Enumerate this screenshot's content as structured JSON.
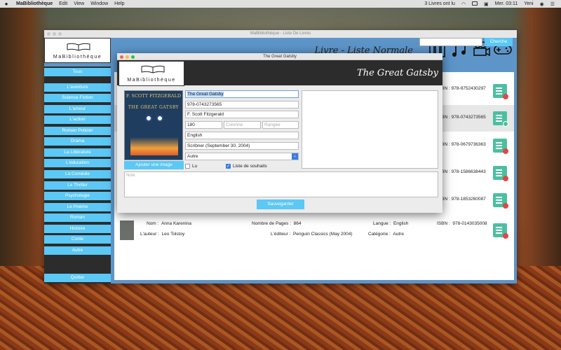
{
  "menubar": {
    "app": "MaBibliothèque",
    "items": [
      "Edit",
      "View",
      "Window",
      "Help"
    ],
    "status": "3 Livres ont lu",
    "clock": "Mer. 03:11",
    "user": "Yeni"
  },
  "main_window": {
    "title": "MaBibliothèque - Liste De Livres",
    "logo_text": "MaBibliothèque",
    "header": "Livre - Liste Normale",
    "search_placeholder": "",
    "search_button": "Cherche",
    "sidebar": {
      "items": [
        "Tous",
        "L'aventure",
        "Science-Fiction",
        "L'amour",
        "L'action",
        "Roman Policier",
        "Drama",
        "La Littérature",
        "L'éducation",
        "La Comédie",
        "Le Thriller",
        "Psychologie",
        "Le Poème",
        "Roman",
        "Histoire",
        "Conte",
        "Autre"
      ],
      "quit": "Quitter"
    },
    "rows": [
      {
        "isbn_label": "ISBN :",
        "isbn": "978-9752430297",
        "status": "unread"
      },
      {
        "isbn_label": "ISBN :",
        "isbn": "978-0743273565",
        "status": "read"
      },
      {
        "isbn_label": "ISBN :",
        "isbn": "978-0679736363",
        "status": "unread"
      },
      {
        "isbn_label": "ISBN :",
        "isbn": "978-1586638443",
        "status": "read"
      },
      {
        "isbn_label": "ISBN :",
        "isbn": "978-1853260087",
        "status": "unread"
      },
      {
        "name_label": "Nom :",
        "name": "Anna Karenina",
        "pages_label": "Nombre de Pages :",
        "pages": "864",
        "lang_label": "Langue :",
        "lang": "English",
        "isbn_label": "ISBN :",
        "isbn": "978-0143035008",
        "author_label": "L'auteur :",
        "author": "Leo Tolstoy",
        "editor_label": "L'éditeur :",
        "editor": "Penguin Classics (May 2004)",
        "cat_label": "Catégorie :",
        "cat": "Autre",
        "status": "read"
      }
    ]
  },
  "dialog": {
    "title": "The Great Gatsby",
    "logo_text": "MaBibliothèque",
    "header_title": "The Great Gatsby",
    "cover": {
      "author": "F. SCOTT FITZGERALD",
      "title": "THE GREAT GATSBY"
    },
    "add_image": "Ajouter une image",
    "fields": {
      "name": "The Great Gatsby",
      "isbn": "978-0743273565",
      "author": "F. Scott Fitzgerald",
      "pages": "180",
      "column_placeholder": "Colonne",
      "row_placeholder": "Rangée",
      "language": "English",
      "editor": "Scribner (September 30, 2004)",
      "category": "Autre"
    },
    "read_label": "Lu",
    "read_checked": false,
    "wishlist_label": "Liste de souhaits",
    "wishlist_checked": true,
    "note_placeholder": "Note",
    "save": "Sauvegarder"
  }
}
